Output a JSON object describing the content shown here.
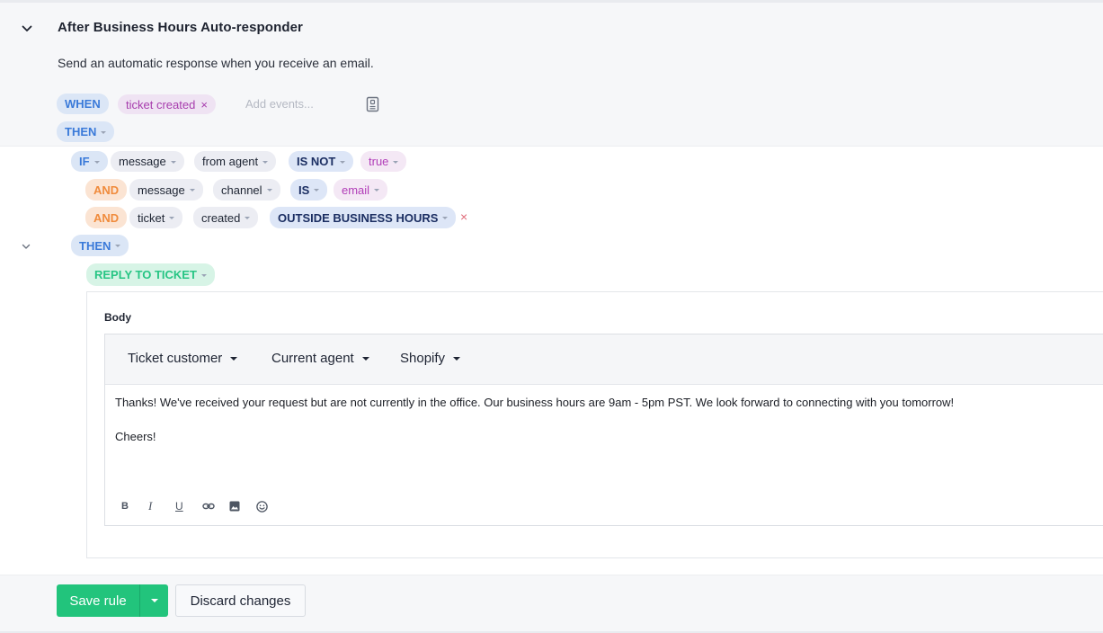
{
  "rule": {
    "title": "After Business Hours Auto-responder",
    "description": "Send an automatic response when you receive an email."
  },
  "trigger": {
    "when_label": "WHEN",
    "event": "ticket created",
    "event_remove": "×",
    "add_events_placeholder": "Add events...",
    "then_label": "THEN"
  },
  "conditions": {
    "if_label": "IF",
    "rows": [
      {
        "connector": "IF",
        "object": "message",
        "field": "from agent",
        "operator": "IS NOT",
        "value": "true"
      },
      {
        "connector": "AND",
        "object": "message",
        "field": "channel",
        "operator": "IS",
        "value": "email"
      },
      {
        "connector": "AND",
        "object": "ticket",
        "field": "created",
        "operator": "OUTSIDE BUSINESS HOURS",
        "value": ""
      }
    ],
    "remove_glyph": "×"
  },
  "actions": {
    "then_label": "THEN",
    "action_label": "REPLY TO TICKET",
    "body_label": "Body",
    "variable_menus": [
      "Ticket customer",
      "Current agent",
      "Shopify"
    ],
    "body_lines": [
      "Thanks! We've received your request but are not currently in the office. Our business hours are 9am - 5pm PST. We look forward to connecting with you tomorrow!",
      "Cheers!"
    ],
    "format_buttons": [
      "bold-icon",
      "italic-icon",
      "underline-icon",
      "link-icon",
      "image-icon",
      "emoji-icon"
    ],
    "format_labels": {
      "bold": "B",
      "italic": "I",
      "underline": "U"
    }
  },
  "footer": {
    "save_label": "Save rule",
    "discard_label": "Discard changes"
  },
  "colors": {
    "accent_green": "#22c47c",
    "keyword_blue": "#3a7ad9",
    "keyword_orange": "#f08b3c",
    "value_purple": "#b13db8"
  }
}
